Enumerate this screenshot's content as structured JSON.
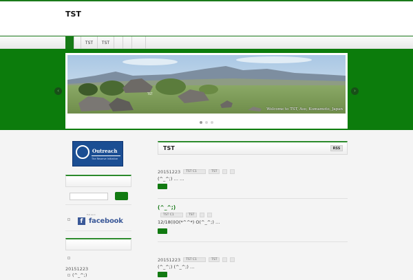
{
  "site": {
    "title": "TST"
  },
  "nav": {
    "items": [
      "",
      "TST",
      "TST",
      "",
      "",
      ""
    ]
  },
  "hero": {
    "caption": "Welcome to TST, Aso, Kumamoto, Japan",
    "left_arrow": "‹",
    "right_arrow": "›",
    "slides": 3,
    "active_slide": 0
  },
  "sidebar": {
    "outreach": {
      "title": "Outreach",
      "subtitle": "The Reserve Initiative"
    },
    "facebook": {
      "small": "Find us on",
      "brand": "facebook",
      "letter": "f"
    },
    "date": "20151223",
    "list_item": "(^_^;)"
  },
  "main": {
    "title": "TST",
    "rss": "RSS",
    "posts": [
      {
        "date": "20151223",
        "category": "TST C1",
        "tag": "TST",
        "title": "",
        "excerpt": "(^_^;)  …  …"
      },
      {
        "date": "",
        "category": "TST C1",
        "tag": "TST",
        "title": "(^_^;)",
        "excerpt": "12/18(I)O(*^^*)   O(^_^;)  …"
      },
      {
        "date": "20151223",
        "category": "TST C1",
        "tag": "TST",
        "title": "",
        "excerpt": "(^_^;)  (^_^;)    …"
      }
    ]
  },
  "colors": {
    "brand_green": "#0c7c0c",
    "link_green": "#187a18",
    "facebook_blue": "#3b5998",
    "outreach_blue": "#1b4e93"
  }
}
